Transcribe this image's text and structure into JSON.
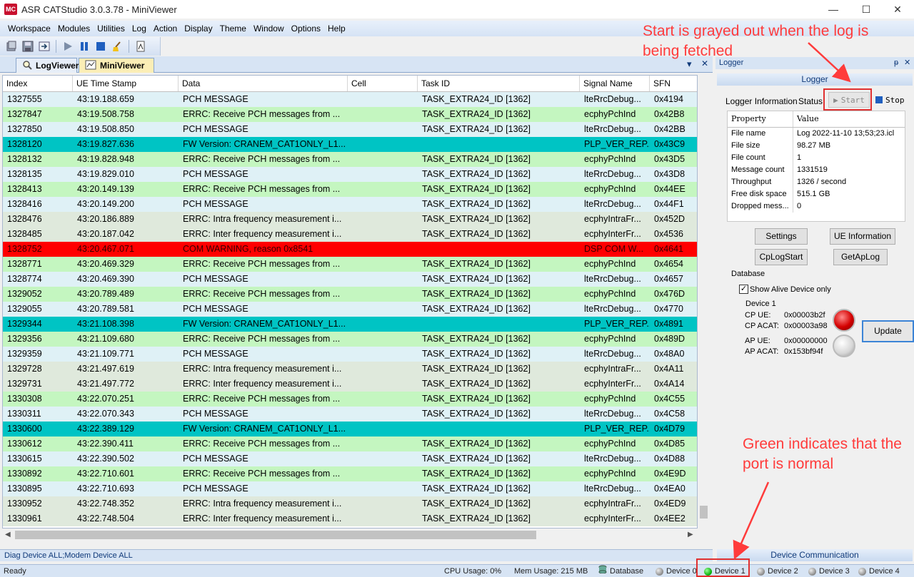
{
  "window": {
    "title": "ASR CATStudio 3.0.3.78 - MiniViewer",
    "logo_text": "MC",
    "minimize": "—",
    "maximize": "☐",
    "close": "✕"
  },
  "menu": [
    "Workspace",
    "Modules",
    "Utilities",
    "Log",
    "Action",
    "Display",
    "Theme",
    "Window",
    "Options",
    "Help"
  ],
  "tabs": [
    {
      "label": "LogViewer"
    },
    {
      "label": "MiniViewer"
    }
  ],
  "tabbar_controls": {
    "dropdown": "▾",
    "close": "✕"
  },
  "grid": {
    "columns": [
      "Index",
      "UE Time Stamp",
      "Data",
      "Cell",
      "Task ID",
      "Signal Name",
      "SFN"
    ],
    "rows": [
      {
        "type": "pch",
        "cells": [
          "1327555",
          "43:19.188.659",
          "PCH MESSAGE",
          "",
          "TASK_EXTRA24_ID [1362]",
          "lteRrcDebug...",
          "0x4194"
        ]
      },
      {
        "type": "errc",
        "cells": [
          "1327847",
          "43:19.508.758",
          "ERRC: Receive PCH messages from ...",
          "",
          "TASK_EXTRA24_ID [1362]",
          "ecphyPchInd",
          "0x42B8"
        ]
      },
      {
        "type": "pch",
        "cells": [
          "1327850",
          "43:19.508.850",
          "PCH MESSAGE",
          "",
          "TASK_EXTRA24_ID [1362]",
          "lteRrcDebug...",
          "0x42BB"
        ]
      },
      {
        "type": "fw",
        "cells": [
          "1328120",
          "43:19.827.636",
          "FW Version: CRANEM_CAT1ONLY_L1...",
          "",
          "",
          "PLP_VER_REP...",
          "0x43C9"
        ]
      },
      {
        "type": "errc",
        "cells": [
          "1328132",
          "43:19.828.948",
          "ERRC: Receive PCH messages from ...",
          "",
          "TASK_EXTRA24_ID [1362]",
          "ecphyPchInd",
          "0x43D5"
        ]
      },
      {
        "type": "pch",
        "cells": [
          "1328135",
          "43:19.829.010",
          "PCH MESSAGE",
          "",
          "TASK_EXTRA24_ID [1362]",
          "lteRrcDebug...",
          "0x43D8"
        ]
      },
      {
        "type": "errc",
        "cells": [
          "1328413",
          "43:20.149.139",
          "ERRC: Receive PCH messages from ...",
          "",
          "TASK_EXTRA24_ID [1362]",
          "ecphyPchInd",
          "0x44EE"
        ]
      },
      {
        "type": "pch",
        "cells": [
          "1328416",
          "43:20.149.200",
          "PCH MESSAGE",
          "",
          "TASK_EXTRA24_ID [1362]",
          "lteRrcDebug...",
          "0x44F1"
        ]
      },
      {
        "type": "intra",
        "cells": [
          "1328476",
          "43:20.186.889",
          "ERRC: Intra frequency measurement i...",
          "",
          "TASK_EXTRA24_ID [1362]",
          "ecphyIntraFr...",
          "0x452D"
        ]
      },
      {
        "type": "intra",
        "cells": [
          "1328485",
          "43:20.187.042",
          "ERRC: Inter frequency measurement i...",
          "",
          "TASK_EXTRA24_ID [1362]",
          "ecphyInterFr...",
          "0x4536"
        ]
      },
      {
        "type": "warn",
        "cells": [
          "1328752",
          "43:20.467.071",
          "COM WARNING, reason 0x8541",
          "",
          "",
          "DSP COM W...",
          "0x4641"
        ]
      },
      {
        "type": "errc",
        "cells": [
          "1328771",
          "43:20.469.329",
          "ERRC: Receive PCH messages from ...",
          "",
          "TASK_EXTRA24_ID [1362]",
          "ecphyPchInd",
          "0x4654"
        ]
      },
      {
        "type": "pch",
        "cells": [
          "1328774",
          "43:20.469.390",
          "PCH MESSAGE",
          "",
          "TASK_EXTRA24_ID [1362]",
          "lteRrcDebug...",
          "0x4657"
        ]
      },
      {
        "type": "errc",
        "cells": [
          "1329052",
          "43:20.789.489",
          "ERRC: Receive PCH messages from ...",
          "",
          "TASK_EXTRA24_ID [1362]",
          "ecphyPchInd",
          "0x476D"
        ]
      },
      {
        "type": "pch",
        "cells": [
          "1329055",
          "43:20.789.581",
          "PCH MESSAGE",
          "",
          "TASK_EXTRA24_ID [1362]",
          "lteRrcDebug...",
          "0x4770"
        ]
      },
      {
        "type": "fw",
        "cells": [
          "1329344",
          "43:21.108.398",
          "FW Version: CRANEM_CAT1ONLY_L1...",
          "",
          "",
          "PLP_VER_REP...",
          "0x4891"
        ]
      },
      {
        "type": "errc",
        "cells": [
          "1329356",
          "43:21.109.680",
          "ERRC: Receive PCH messages from ...",
          "",
          "TASK_EXTRA24_ID [1362]",
          "ecphyPchInd",
          "0x489D"
        ]
      },
      {
        "type": "pch",
        "cells": [
          "1329359",
          "43:21.109.771",
          "PCH MESSAGE",
          "",
          "TASK_EXTRA24_ID [1362]",
          "lteRrcDebug...",
          "0x48A0"
        ]
      },
      {
        "type": "intra",
        "cells": [
          "1329728",
          "43:21.497.619",
          "ERRC: Intra frequency measurement i...",
          "",
          "TASK_EXTRA24_ID [1362]",
          "ecphyIntraFr...",
          "0x4A11"
        ]
      },
      {
        "type": "intra",
        "cells": [
          "1329731",
          "43:21.497.772",
          "ERRC: Inter frequency measurement i...",
          "",
          "TASK_EXTRA24_ID [1362]",
          "ecphyInterFr...",
          "0x4A14"
        ]
      },
      {
        "type": "errc",
        "cells": [
          "1330308",
          "43:22.070.251",
          "ERRC: Receive PCH messages from ...",
          "",
          "TASK_EXTRA24_ID [1362]",
          "ecphyPchInd",
          "0x4C55"
        ]
      },
      {
        "type": "pch",
        "cells": [
          "1330311",
          "43:22.070.343",
          "PCH MESSAGE",
          "",
          "TASK_EXTRA24_ID [1362]",
          "lteRrcDebug...",
          "0x4C58"
        ]
      },
      {
        "type": "fw",
        "cells": [
          "1330600",
          "43:22.389.129",
          "FW Version: CRANEM_CAT1ONLY_L1...",
          "",
          "",
          "PLP_VER_REP...",
          "0x4D79"
        ]
      },
      {
        "type": "errc",
        "cells": [
          "1330612",
          "43:22.390.411",
          "ERRC: Receive PCH messages from ...",
          "",
          "TASK_EXTRA24_ID [1362]",
          "ecphyPchInd",
          "0x4D85"
        ]
      },
      {
        "type": "pch",
        "cells": [
          "1330615",
          "43:22.390.502",
          "PCH MESSAGE",
          "",
          "TASK_EXTRA24_ID [1362]",
          "lteRrcDebug...",
          "0x4D88"
        ]
      },
      {
        "type": "errc",
        "cells": [
          "1330892",
          "43:22.710.601",
          "ERRC: Receive PCH messages from ...",
          "",
          "TASK_EXTRA24_ID [1362]",
          "ecphyPchInd",
          "0x4E9D"
        ]
      },
      {
        "type": "pch",
        "cells": [
          "1330895",
          "43:22.710.693",
          "PCH MESSAGE",
          "",
          "TASK_EXTRA24_ID [1362]",
          "lteRrcDebug...",
          "0x4EA0"
        ]
      },
      {
        "type": "intra",
        "cells": [
          "1330952",
          "43:22.748.352",
          "ERRC: Intra frequency measurement i...",
          "",
          "TASK_EXTRA24_ID [1362]",
          "ecphyIntraFr...",
          "0x4ED9"
        ]
      },
      {
        "type": "intra",
        "cells": [
          "1330961",
          "43:22.748.504",
          "ERRC: Inter frequency measurement i...",
          "",
          "TASK_EXTRA24_ID [1362]",
          "ecphyInterFr...",
          "0x4EE2"
        ]
      }
    ]
  },
  "diag_status": "Diag Device ALL;Modem Device ALL",
  "logger_panel": {
    "title": "Logger",
    "pin": "ᵽ",
    "close": "✕",
    "section": "Logger",
    "info_label": "Logger Information",
    "status_label": "Status:",
    "start_label": "Start",
    "stop_label": "Stop",
    "property_header": "Property",
    "value_header": "Value",
    "properties": [
      {
        "name": "File name",
        "value": "Log 2022-11-10 13;53;23.icl"
      },
      {
        "name": "File size",
        "value": "98.27 MB"
      },
      {
        "name": "File count",
        "value": "1"
      },
      {
        "name": "Message count",
        "value": "1331519"
      },
      {
        "name": "Throughput",
        "value": "1326 / second"
      },
      {
        "name": "Free disk space",
        "value": "515.1 GB"
      },
      {
        "name": "Dropped mess...",
        "value": "0"
      }
    ],
    "buttons": {
      "settings": "Settings",
      "ue_information": "UE Information",
      "cplogstart": "CpLogStart",
      "getaplog": "GetApLog",
      "update": "Update"
    },
    "database_label": "Database",
    "show_alive_label": "Show Alive Device only",
    "show_alive_checked": true,
    "device_label": "Device 1",
    "cp_ue_label": "CP UE:",
    "cp_ue_value": "0x00003b2f",
    "cp_acat_label": "CP ACAT:",
    "cp_acat_value": "0x00003a98",
    "ap_ue_label": "AP UE:",
    "ap_ue_value": "0x00000000",
    "ap_acat_label": "AP ACAT:",
    "ap_acat_value": "0x153bf94f",
    "device_comm": "Device Communication"
  },
  "statusbar": {
    "ready": "Ready",
    "cpu": "CPU Usage:  0%",
    "mem": "Mem Usage: 215 MB",
    "database": "Database",
    "devices": [
      "Device 0",
      "Device 1",
      "Device 2",
      "Device 3",
      "Device 4"
    ]
  },
  "annotations": {
    "start_note": "Start is grayed out when the log is being fetched",
    "green_note": "Green indicates that the port is normal"
  },
  "colors": {
    "pch_row": "#dff1f6",
    "errc_row": "#c4f6c0",
    "measurement_row": "#dfe9dc",
    "fw_row": "#00c4c4",
    "warning_row": "#ff0000",
    "annotation": "#ff3b3b"
  }
}
